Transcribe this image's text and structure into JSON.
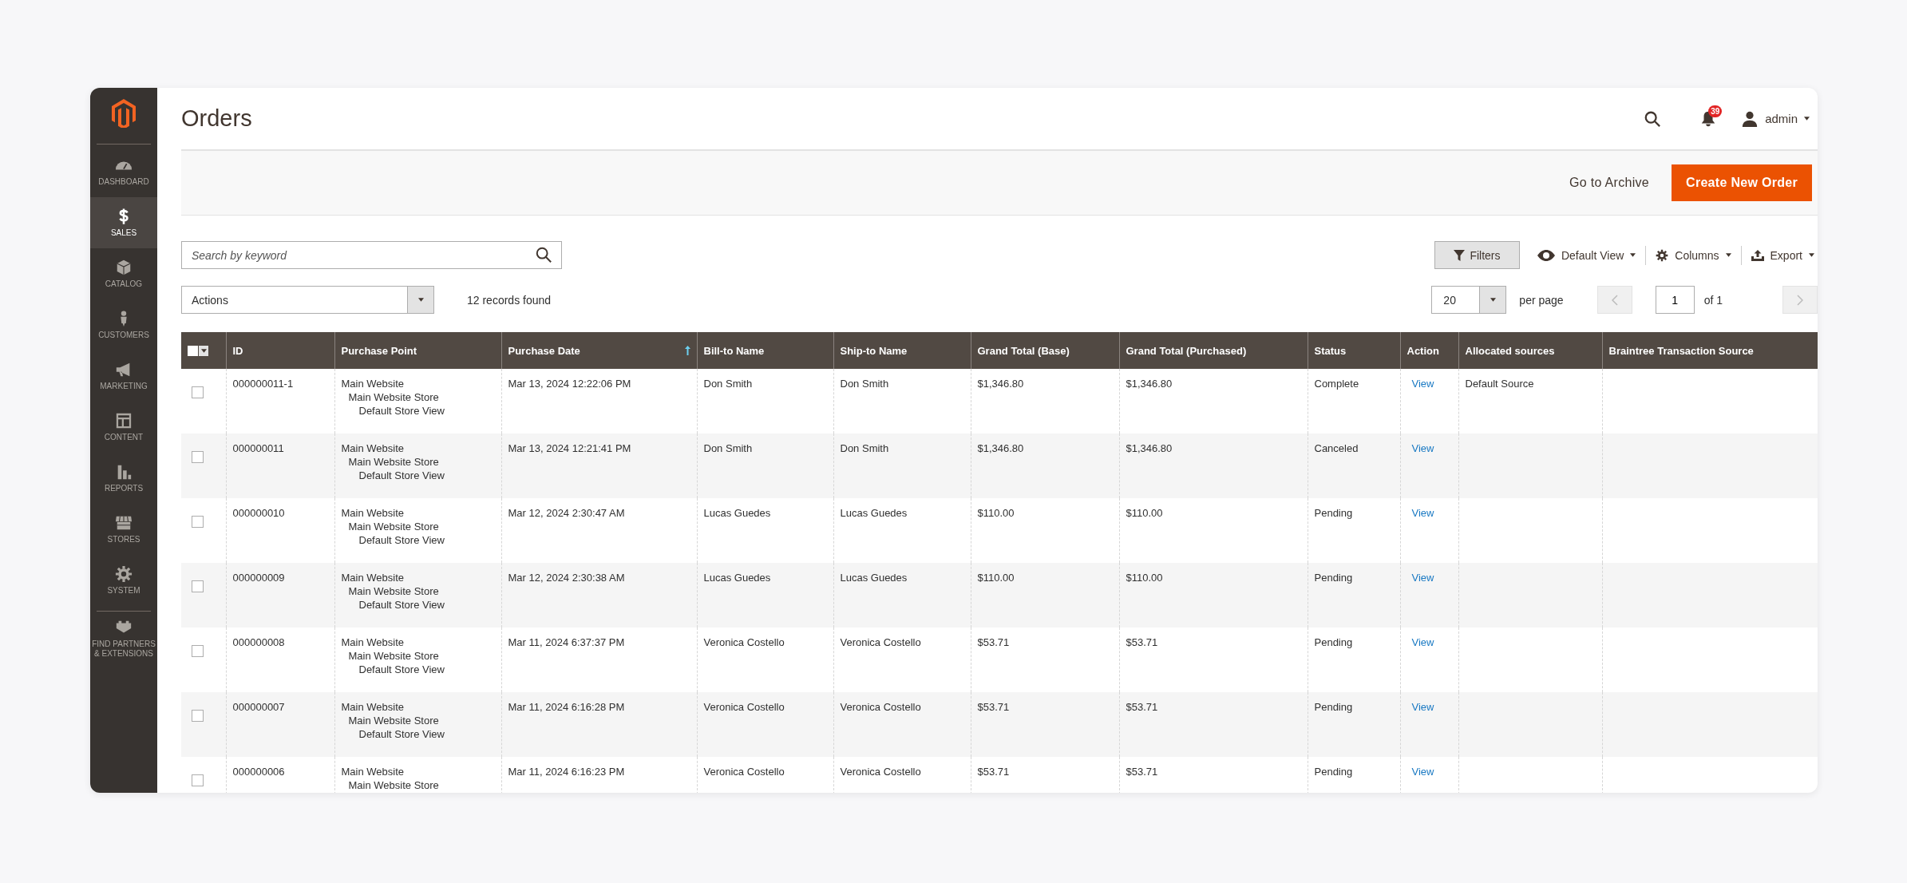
{
  "sidebar": {
    "items": [
      {
        "label": "DASHBOARD",
        "selected": false
      },
      {
        "label": "SALES",
        "selected": true
      },
      {
        "label": "CATALOG",
        "selected": false
      },
      {
        "label": "CUSTOMERS",
        "selected": false
      },
      {
        "label": "MARKETING",
        "selected": false
      },
      {
        "label": "CONTENT",
        "selected": false
      },
      {
        "label": "REPORTS",
        "selected": false
      },
      {
        "label": "STORES",
        "selected": false
      },
      {
        "label": "SYSTEM",
        "selected": false
      },
      {
        "label": "FIND PARTNERS & EXTENSIONS",
        "selected": false
      }
    ]
  },
  "header": {
    "title": "Orders",
    "notifications": "39",
    "user": "admin"
  },
  "action_bar": {
    "link": "Go to Archive",
    "button": "Create New Order"
  },
  "toolbar": {
    "search": {
      "placeholder": "Search by keyword"
    },
    "filters": "Filters",
    "view": "Default View",
    "columns": "Columns",
    "export": "Export"
  },
  "list_controls": {
    "actions": "Actions",
    "records": "12 records found",
    "page_size": "20",
    "per_page": "per page",
    "page": "1",
    "of": "of 1",
    "prev": {
      "disabled": true
    },
    "next": {
      "disabled": true
    }
  },
  "table": {
    "header_checkbox": {
      "checked": false
    },
    "columns": [
      {
        "label": "ID",
        "sorted": false
      },
      {
        "label": "Purchase Point",
        "sorted": false
      },
      {
        "label": "Purchase Date",
        "sorted": true
      },
      {
        "label": "Bill-to Name",
        "sorted": false
      },
      {
        "label": "Ship-to Name",
        "sorted": false
      },
      {
        "label": "Grand Total (Base)",
        "sorted": false
      },
      {
        "label": "Grand Total (Purchased)",
        "sorted": false
      },
      {
        "label": "Status",
        "sorted": false
      },
      {
        "label": "Action",
        "sorted": false
      },
      {
        "label": "Allocated sources",
        "sorted": false
      },
      {
        "label": "Braintree Transaction Source",
        "sorted": false
      }
    ],
    "rows": [
      {
        "checked": false,
        "id": "000000011-1",
        "purchase_point": [
          "Main Website",
          "Main Website Store",
          "Default Store View"
        ],
        "purchase_date": "Mar 13, 2024 12:22:06 PM",
        "bill_to": "Don Smith",
        "ship_to": "Don Smith",
        "total_base": "$1,346.80",
        "total_purchased": "$1,346.80",
        "status": "Complete",
        "action": "View",
        "allocated_sources": "Default Source"
      },
      {
        "checked": false,
        "id": "000000011",
        "purchase_point": [
          "Main Website",
          "Main Website Store",
          "Default Store View"
        ],
        "purchase_date": "Mar 13, 2024 12:21:41 PM",
        "bill_to": "Don Smith",
        "ship_to": "Don Smith",
        "total_base": "$1,346.80",
        "total_purchased": "$1,346.80",
        "status": "Canceled",
        "action": "View"
      },
      {
        "checked": false,
        "id": "000000010",
        "purchase_point": [
          "Main Website",
          "Main Website Store",
          "Default Store View"
        ],
        "purchase_date": "Mar 12, 2024 2:30:47 AM",
        "bill_to": "Lucas Guedes",
        "ship_to": "Lucas Guedes",
        "total_base": "$110.00",
        "total_purchased": "$110.00",
        "status": "Pending",
        "action": "View"
      },
      {
        "checked": false,
        "id": "000000009",
        "purchase_point": [
          "Main Website",
          "Main Website Store",
          "Default Store View"
        ],
        "purchase_date": "Mar 12, 2024 2:30:38 AM",
        "bill_to": "Lucas Guedes",
        "ship_to": "Lucas Guedes",
        "total_base": "$110.00",
        "total_purchased": "$110.00",
        "status": "Pending",
        "action": "View"
      },
      {
        "checked": false,
        "id": "000000008",
        "purchase_point": [
          "Main Website",
          "Main Website Store",
          "Default Store View"
        ],
        "purchase_date": "Mar 11, 2024 6:37:37 PM",
        "bill_to": "Veronica Costello",
        "ship_to": "Veronica Costello",
        "total_base": "$53.71",
        "total_purchased": "$53.71",
        "status": "Pending",
        "action": "View"
      },
      {
        "checked": false,
        "id": "000000007",
        "purchase_point": [
          "Main Website",
          "Main Website Store",
          "Default Store View"
        ],
        "purchase_date": "Mar 11, 2024 6:16:28 PM",
        "bill_to": "Veronica Costello",
        "ship_to": "Veronica Costello",
        "total_base": "$53.71",
        "total_purchased": "$53.71",
        "status": "Pending",
        "action": "View"
      },
      {
        "checked": false,
        "id": "000000006",
        "purchase_point": [
          "Main Website",
          "Main Website Store"
        ],
        "purchase_date": "Mar 11, 2024 6:16:23 PM",
        "bill_to": "Veronica Costello",
        "ship_to": "Veronica Costello",
        "total_base": "$53.71",
        "total_purchased": "$53.71",
        "status": "Pending",
        "action": "View"
      }
    ]
  }
}
